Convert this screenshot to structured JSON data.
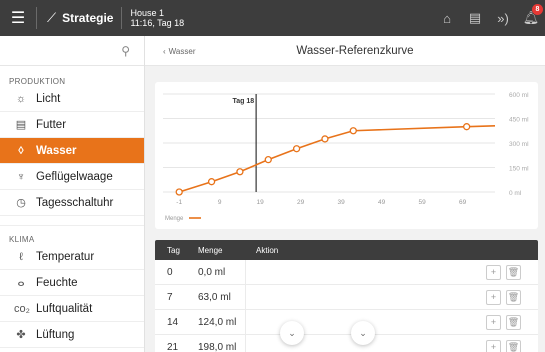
{
  "topbar": {
    "brand": "Strategie",
    "house": "House 1",
    "context": "11:16, Tag 18",
    "badge_count": "8",
    "icons": [
      "menu-icon",
      "strategy-icon",
      "house-icon",
      "report-icon",
      "signal-icon",
      "bell-icon"
    ]
  },
  "sidebar": {
    "section1": "PRODUKTION",
    "section2": "KLIMA",
    "items1": [
      {
        "label": "Licht",
        "icon": "☼"
      },
      {
        "label": "Futter",
        "icon": "▤"
      },
      {
        "label": "Wasser",
        "icon": "◊"
      },
      {
        "label": "Geflügelwaage",
        "icon": "♆"
      },
      {
        "label": "Tagesschaltuhr",
        "icon": "◷"
      }
    ],
    "items2": [
      {
        "label": "Temperatur",
        "icon": "ℓ"
      },
      {
        "label": "Feuchte",
        "icon": "ⴰ"
      },
      {
        "label": "Luftqualität",
        "icon": "co₂"
      },
      {
        "label": "Lüftung",
        "icon": "✤"
      }
    ],
    "active": "Wasser"
  },
  "main": {
    "back_label": "Wasser",
    "title": "Wasser-Referenzkurve"
  },
  "chart_data": {
    "type": "line",
    "marker_label": "Tag 18",
    "marker_x": 18,
    "x_ticks": [
      -1,
      9,
      19,
      29,
      39,
      49,
      59,
      69
    ],
    "y_ticks": [
      "0 ml",
      "150 ml",
      "300 ml",
      "450 ml",
      "600 ml"
    ],
    "ylim": [
      0,
      600
    ],
    "xlim": [
      -5,
      77
    ],
    "series": [
      {
        "name": "Menge",
        "color": "#e8731a",
        "points": [
          [
            -1,
            0
          ],
          [
            7,
            63
          ],
          [
            14,
            124
          ],
          [
            21,
            198
          ],
          [
            28,
            265
          ],
          [
            35,
            325
          ],
          [
            42,
            375
          ],
          [
            70,
            400
          ],
          [
            77,
            405
          ]
        ]
      }
    ],
    "legend": "Menge"
  },
  "table": {
    "headers": {
      "tag": "Tag",
      "menge": "Menge",
      "aktion": "Aktion"
    },
    "rows": [
      {
        "tag": "0",
        "menge": "0,0 ml"
      },
      {
        "tag": "7",
        "menge": "63,0 ml"
      },
      {
        "tag": "14",
        "menge": "124,0 ml"
      },
      {
        "tag": "21",
        "menge": "198,0 ml"
      }
    ]
  }
}
